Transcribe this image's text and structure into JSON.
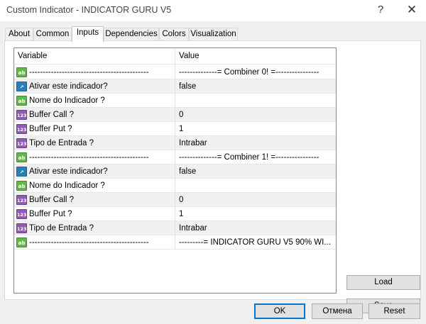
{
  "window": {
    "title": "Custom Indicator - INDICATOR GURU V5",
    "help_glyph": "?",
    "close_glyph": "✕"
  },
  "tabs": [
    {
      "label": "About"
    },
    {
      "label": "Common"
    },
    {
      "label": "Inputs"
    },
    {
      "label": "Dependencies"
    },
    {
      "label": "Colors"
    },
    {
      "label": "Visualization"
    }
  ],
  "grid": {
    "header_variable": "Variable",
    "header_value": "Value",
    "rows": [
      {
        "icon": "ab",
        "variable": "--------------------------------------------",
        "value": "--------------= Combiner 0! =----------------"
      },
      {
        "icon": "bool",
        "variable": "Ativar este indicador?",
        "value": "false"
      },
      {
        "icon": "ab",
        "variable": "Nome do Indicador ?",
        "value": ""
      },
      {
        "icon": "123",
        "variable": "Buffer Call ?",
        "value": "0"
      },
      {
        "icon": "123",
        "variable": "Buffer Put ?",
        "value": "1"
      },
      {
        "icon": "123",
        "variable": "Tipo de Entrada ?",
        "value": "Intrabar"
      },
      {
        "icon": "ab",
        "variable": "--------------------------------------------",
        "value": "--------------= Combiner 1! =----------------"
      },
      {
        "icon": "bool",
        "variable": "Ativar este indicador?",
        "value": "false"
      },
      {
        "icon": "ab",
        "variable": "Nome do Indicador ?",
        "value": ""
      },
      {
        "icon": "123",
        "variable": "Buffer Call ?",
        "value": "0"
      },
      {
        "icon": "123",
        "variable": "Buffer Put ?",
        "value": "1"
      },
      {
        "icon": "123",
        "variable": "Tipo de Entrada ?",
        "value": "Intrabar"
      },
      {
        "icon": "ab",
        "variable": "--------------------------------------------",
        "value": "---------= INDICATOR GURU V5 90% WI..."
      }
    ]
  },
  "side_buttons": {
    "load": "Load",
    "save": "Save"
  },
  "bottom_buttons": {
    "ok": "OK",
    "cancel": "Отмена",
    "reset": "Reset"
  },
  "icon_labels": {
    "ab": "ab",
    "123": "123",
    "bool": "↗"
  }
}
